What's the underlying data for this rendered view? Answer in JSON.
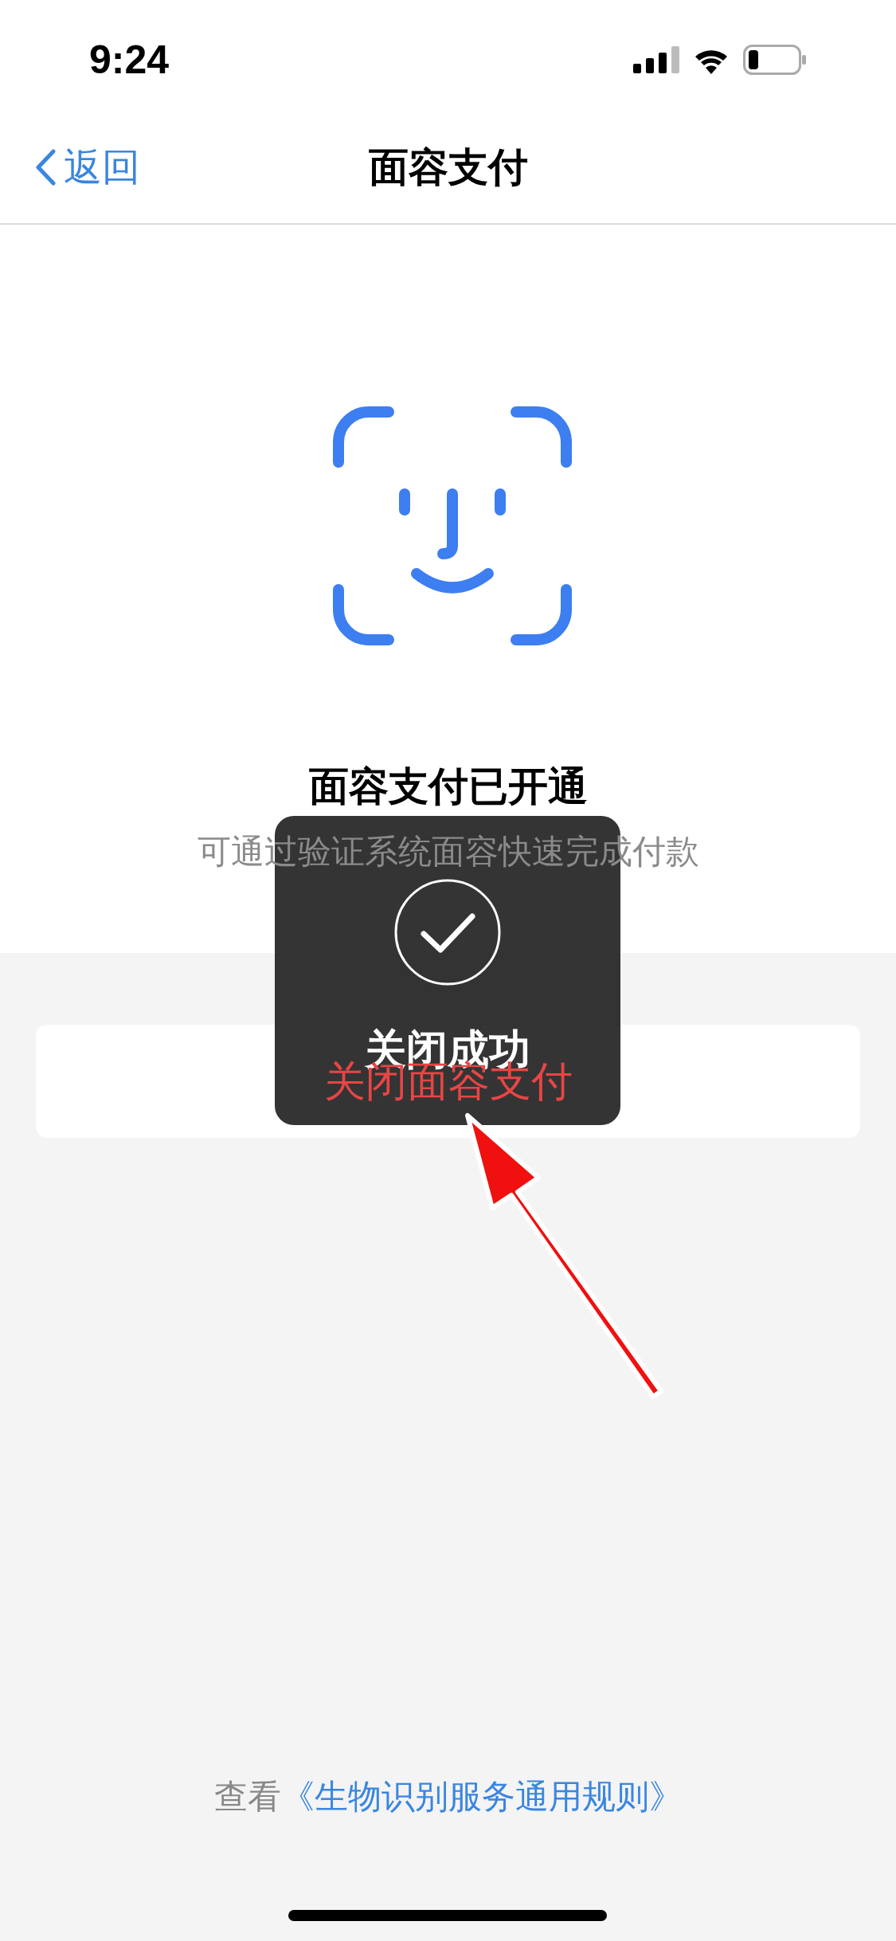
{
  "status_bar": {
    "time": "9:24"
  },
  "nav": {
    "back": "返回",
    "title": "面容支付"
  },
  "status": {
    "title": "面容支付已开通",
    "subtitle": "可通过验证系统面容快速完成付款"
  },
  "action_button": "关闭面容支付",
  "toast": {
    "message": "关闭成功"
  },
  "footer": {
    "prefix": "查看",
    "link": "《生物识别服务通用规则》"
  }
}
